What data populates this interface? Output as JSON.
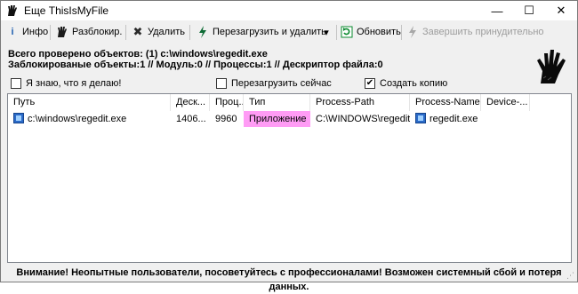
{
  "window": {
    "title": "Еще ThisIsMyFile",
    "controls": {
      "minimize": "—",
      "maximize": "☐",
      "close": "✕"
    }
  },
  "toolbar": {
    "info": "Инфо",
    "unlock": "Разблокир.",
    "delete": "Удалить",
    "reboot_delete": "Перезагрузить и удалить",
    "dropdown": "▾",
    "refresh": "Обновить",
    "terminate": "Завершить принудительно"
  },
  "summary": {
    "line1": "Всего проверено объектов: (1) c:\\windows\\regedit.exe",
    "line2": "Заблокированые объекты:1  //  Модуль:0  //  Процессы:1  //  Дескриптор файла:0"
  },
  "options": {
    "i_know": {
      "label": "Я знаю, что я делаю!",
      "checked": false
    },
    "reboot_now": {
      "label": "Перезагрузить сейчас",
      "checked": false
    },
    "create_copy": {
      "label": "Создать копию",
      "checked": true
    }
  },
  "table": {
    "columns": [
      "Путь",
      "Деск...",
      "Проц...",
      "Тип",
      "Process-Path",
      "Process-Name",
      "Device-..."
    ],
    "rows": [
      {
        "path": "c:\\windows\\regedit.exe",
        "desc": "1406...",
        "proc": "9960",
        "type": "Приложение",
        "process_path": "C:\\WINDOWS\\regedit....",
        "process_name": "regedit.exe",
        "device": ""
      }
    ]
  },
  "footer": {
    "warning": "Внимание! Неопытные пользователи, посоветуйтесь с профессионалами! Возможен системный сбой и потеря данных."
  },
  "colors": {
    "type_highlight": "#ff9cf5",
    "refresh_icon": "#0a8a2e",
    "delete_icon": "#2b2b2b",
    "info_icon": "#1f5fb0"
  }
}
